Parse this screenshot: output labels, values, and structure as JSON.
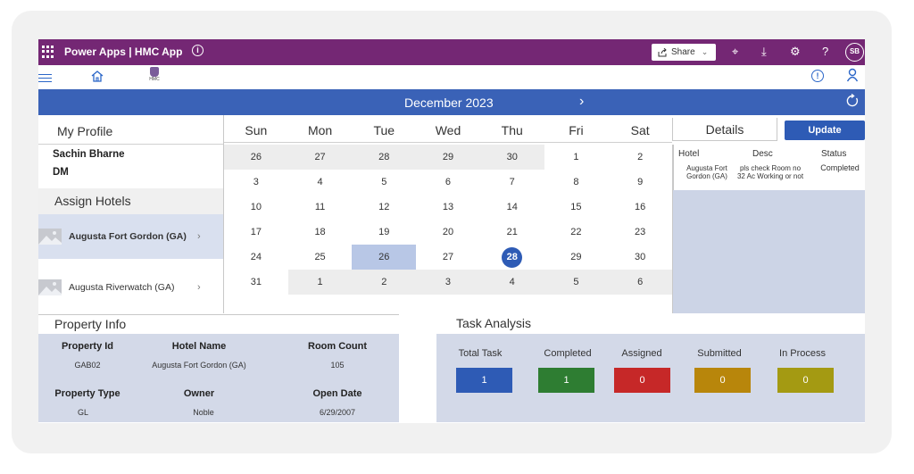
{
  "topbar": {
    "app_title": "Power Apps  |  HMC App",
    "share_label": "Share",
    "avatar_initials": "SB",
    "color": "#742774"
  },
  "subbar": {
    "logo_text": "HMC"
  },
  "calendar": {
    "month_label": "December 2023",
    "days_of_week": [
      "Sun",
      "Mon",
      "Tue",
      "Wed",
      "Thu",
      "Fri",
      "Sat"
    ],
    "weeks": [
      [
        "26",
        "27",
        "28",
        "29",
        "30",
        "1",
        "2"
      ],
      [
        "3",
        "4",
        "5",
        "6",
        "7",
        "8",
        "9"
      ],
      [
        "10",
        "11",
        "12",
        "13",
        "14",
        "15",
        "16"
      ],
      [
        "17",
        "18",
        "19",
        "20",
        "21",
        "22",
        "23"
      ],
      [
        "24",
        "25",
        "26",
        "27",
        "28",
        "29",
        "30"
      ],
      [
        "31",
        "1",
        "2",
        "3",
        "4",
        "5",
        "6"
      ]
    ],
    "highlighted_date": "26",
    "today_date": "28",
    "accent_color": "#2e5bb5"
  },
  "profile": {
    "heading": "My Profile",
    "name": "Sachin Bharne",
    "role": "DM"
  },
  "assign_hotels": {
    "heading": "Assign Hotels",
    "items": [
      {
        "label": "Augusta Fort Gordon (GA)",
        "selected": true
      },
      {
        "label": "Augusta Riverwatch (GA)",
        "selected": false
      }
    ]
  },
  "details": {
    "heading": "Details",
    "update_label": "Update",
    "columns": [
      "Hotel",
      "Desc",
      "Status"
    ],
    "row": {
      "hotel": "Augusta Fort Gordon (GA)",
      "desc": "pls check Room no 32 Ac Working or not",
      "status": "Completed"
    }
  },
  "property_info": {
    "heading": "Property Info",
    "labels": {
      "property_id": "Property Id",
      "hotel_name": "Hotel Name",
      "room_count": "Room Count",
      "property_type": "Property Type",
      "owner": "Owner",
      "open_date": "Open Date"
    },
    "values": {
      "property_id": "GAB02",
      "hotel_name": "Augusta Fort Gordon (GA)",
      "room_count": "105",
      "property_type": "GL",
      "owner": "Noble",
      "open_date": "6/29/2007"
    }
  },
  "task_analysis": {
    "heading": "Task Analysis",
    "items": [
      {
        "label": "Total Task",
        "value": "1",
        "color": "#2e5bb5"
      },
      {
        "label": "Completed",
        "value": "1",
        "color": "#2e7d32"
      },
      {
        "label": "Assigned",
        "value": "0",
        "color": "#c62828"
      },
      {
        "label": "Submitted",
        "value": "0",
        "color": "#b8860b"
      },
      {
        "label": "In Process",
        "value": "0",
        "color": "#a49a12"
      }
    ]
  }
}
